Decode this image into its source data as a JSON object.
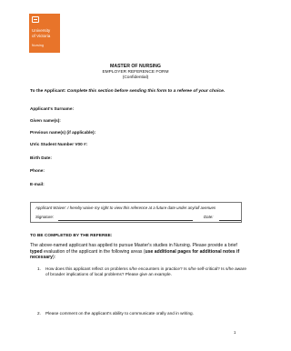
{
  "logo": {
    "line1": "University",
    "line2": "of Victoria",
    "line3": "Nursing"
  },
  "title": {
    "main": "MASTER OF NURSING",
    "sub": "EMPLOYER REFERENCE FORM",
    "confidential": "(Confidential)"
  },
  "instruction": {
    "lead": "To the Applicant:",
    "text": " Complete this section before sending this form to a referee of your choice."
  },
  "fields": [
    "Applicant's Surname:",
    "Given name(s):",
    "Previous name(s) (if applicable):",
    "UVic Student Number V00 #:",
    "Birth Date:",
    "Phone:",
    "E-mail:"
  ],
  "waiver": {
    "text": "Applicant Waiver:  I hereby waive my right to view this reference at a future date under any/all avenues",
    "signature_label": "Signature:",
    "date_label": "Date:"
  },
  "referee": {
    "heading": "TO BE COMPLETED BY THE REFEREE:",
    "para_part1": "The above-named applicant has applied to pursue Master's studies in Nursing. Please provide a brief ",
    "para_bold1": "typed",
    "para_part2": " evaluation of the applicant in the following areas (",
    "para_bold2": "use additional pages for additional notes if necessary",
    "para_part3": "):"
  },
  "questions": [
    {
      "num": "1.",
      "text": "How does this applicant reflect on problems s/he encounters in practice? Is s/he self-critical? Is s/he aware of broader implications of local problems? Please give an example."
    },
    {
      "num": "2.",
      "text": "Please comment on the applicant's ability to communicate orally and in writing."
    }
  ],
  "page_number": "1",
  "colors": {
    "brand": "#e8742a"
  }
}
